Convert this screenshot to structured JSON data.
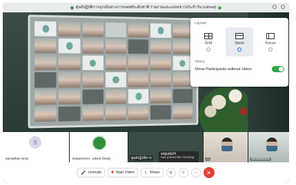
{
  "window": {
    "title": "ศูนย์ปฏิบัติการฉุกเฉินทางการแพทย์ระดับชาติ รายงานและแถลงข่าวประจำวัน (cohost)"
  },
  "layout_popover": {
    "section_title": "Layout",
    "options": [
      {
        "label": "Grid",
        "icon": "grid-layout-icon",
        "selected": false
      },
      {
        "label": "Stack",
        "icon": "stack-layout-icon",
        "selected": true
      },
      {
        "label": "Focus",
        "icon": "focus-layout-icon",
        "selected": false
      }
    ],
    "others_title": "Others",
    "toggle_label": "Show Participants without Video",
    "toggle_on": true
  },
  "participants": [
    {
      "name": "sainaithan (me)",
      "avatar_letter": "S"
    },
    {
      "name": "Department...alized (host)"
    },
    {
      "name": "ศูนย์ปฏิบัติการ"
    },
    {
      "name": "..."
    },
    {
      "name": "1842282423"
    }
  ],
  "join_tooltip": {
    "line1": "sriguda24",
    "line2": "has joined the meeting"
  },
  "toolbar": {
    "unmute": "Unmute",
    "start_video": "Start Video",
    "share": "Share"
  },
  "colors": {
    "accent": "#1a73e8",
    "toggle_on": "#2ea84a",
    "leave": "#e0413a"
  }
}
